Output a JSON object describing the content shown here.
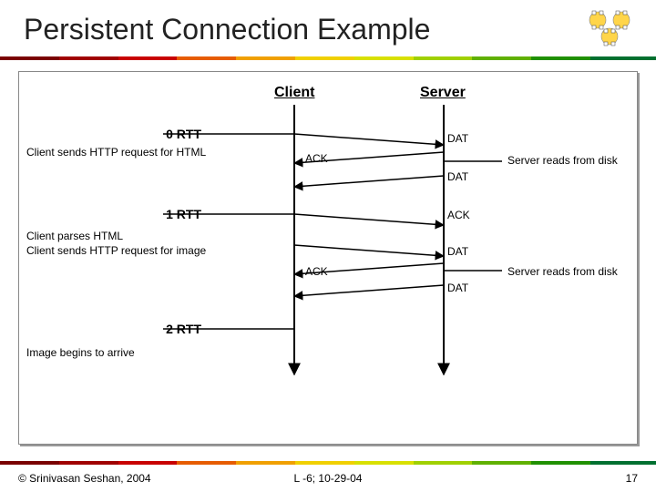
{
  "slide": {
    "title": "Persistent Connection Example",
    "footer_left": "© Srinivasan Seshan, 2004",
    "footer_center": "L -6; 10-29-04",
    "footer_right": "17"
  },
  "labels": {
    "client": "Client",
    "server": "Server",
    "rtt0": "0 RTT",
    "rtt1": "1 RTT",
    "rtt2": "2 RTT",
    "ack": "ACK",
    "dat": "DAT"
  },
  "notes": {
    "client_send_html": "Client sends HTTP request for HTML",
    "client_parse": "Client parses HTML",
    "client_send_image": "Client sends HTTP request for image",
    "server_reads_1": "Server reads from disk",
    "server_reads_2": "Server reads from disk",
    "image_arrive": "Image begins to arrive"
  },
  "chart_data": {
    "type": "sequence-diagram",
    "actors": [
      "Client",
      "Server"
    ],
    "events": [
      {
        "at": "0 RTT",
        "side": "client",
        "action": "Client sends HTTP request for HTML"
      },
      {
        "from": "Client",
        "to": "Server",
        "label": "DAT"
      },
      {
        "side": "server",
        "action": "Server reads from disk"
      },
      {
        "from": "Server",
        "to": "Client",
        "label": "ACK"
      },
      {
        "from": "Server",
        "to": "Client",
        "label": "DAT"
      },
      {
        "at": "1 RTT",
        "from": "Client",
        "to": "Server",
        "label": "ACK"
      },
      {
        "side": "client",
        "action": "Client parses HTML"
      },
      {
        "side": "client",
        "action": "Client sends HTTP request for image"
      },
      {
        "from": "Client",
        "to": "Server",
        "label": "DAT"
      },
      {
        "side": "server",
        "action": "Server reads from disk"
      },
      {
        "from": "Server",
        "to": "Client",
        "label": "ACK"
      },
      {
        "from": "Server",
        "to": "Client",
        "label": "DAT"
      },
      {
        "at": "2 RTT",
        "side": "client",
        "action": "Image begins to arrive"
      }
    ]
  },
  "colors": {
    "accent_bar": [
      "#7a0000",
      "#a00000",
      "#c80000",
      "#e65c00",
      "#f0a000",
      "#f0d000",
      "#d8e000",
      "#a0d000",
      "#60b000",
      "#209000",
      "#007030"
    ]
  }
}
